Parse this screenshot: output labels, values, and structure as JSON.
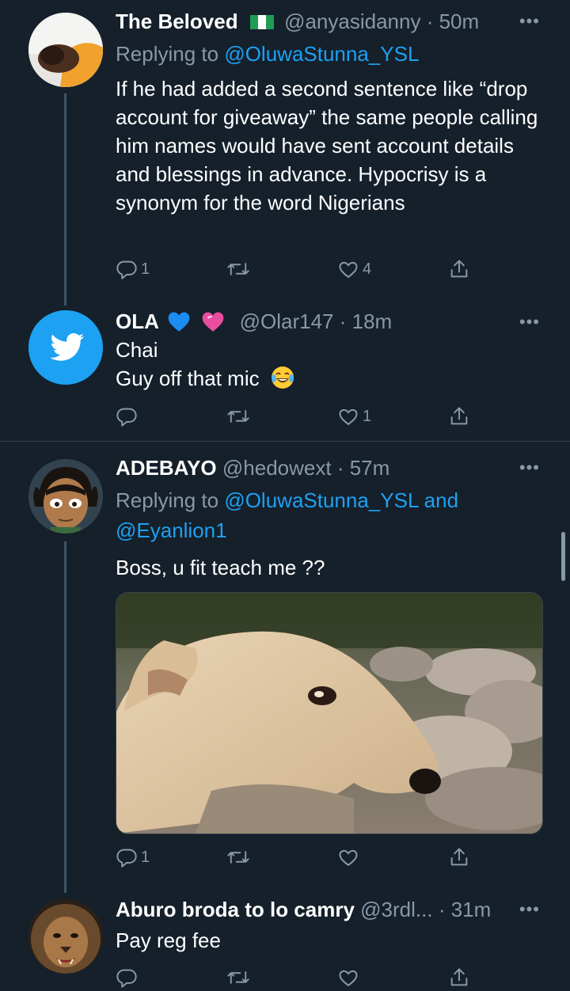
{
  "tweets": [
    {
      "name": "The Beloved",
      "handle": "@anyasidanny",
      "time": "50m",
      "replying_prefix": "Replying to ",
      "replying_to": "@OluwaStunna_YSL",
      "text": "If he had added a second sentence like “drop account for giveaway” the same people calling him names would have sent account details and blessings in advance. Hypocrisy is a synonym for the word Nigerians",
      "replies": "1",
      "retweets": "",
      "likes": "4"
    },
    {
      "name": "OLA",
      "handle": "@Olar147",
      "time": "18m",
      "text_line1": "Chai",
      "text_line2": "Guy off that mic",
      "replies": "",
      "retweets": "",
      "likes": "1"
    },
    {
      "name": "ADEBAYO",
      "handle": "@hedowext",
      "time": "57m",
      "replying_prefix": "Replying to ",
      "replying_to": "@OluwaStunna_YSL",
      "replying_and": " and",
      "replying_to2": "@Eyanlion1",
      "text": "Boss, u fit teach me ??",
      "replies": "1",
      "retweets": "",
      "likes": ""
    },
    {
      "name": "Aburo broda to lo camry",
      "handle": "@3rdl...",
      "time": "31m",
      "text": "Pay reg fee"
    }
  ],
  "separator": "·",
  "more_label": "•••",
  "icons": {
    "reply": "reply-icon",
    "retweet": "retweet-icon",
    "like": "heart-icon",
    "share": "share-icon"
  },
  "colors": {
    "background": "#15202b",
    "secondary_text": "#8899a6",
    "link": "#1da1f2",
    "divider": "#38444d"
  }
}
